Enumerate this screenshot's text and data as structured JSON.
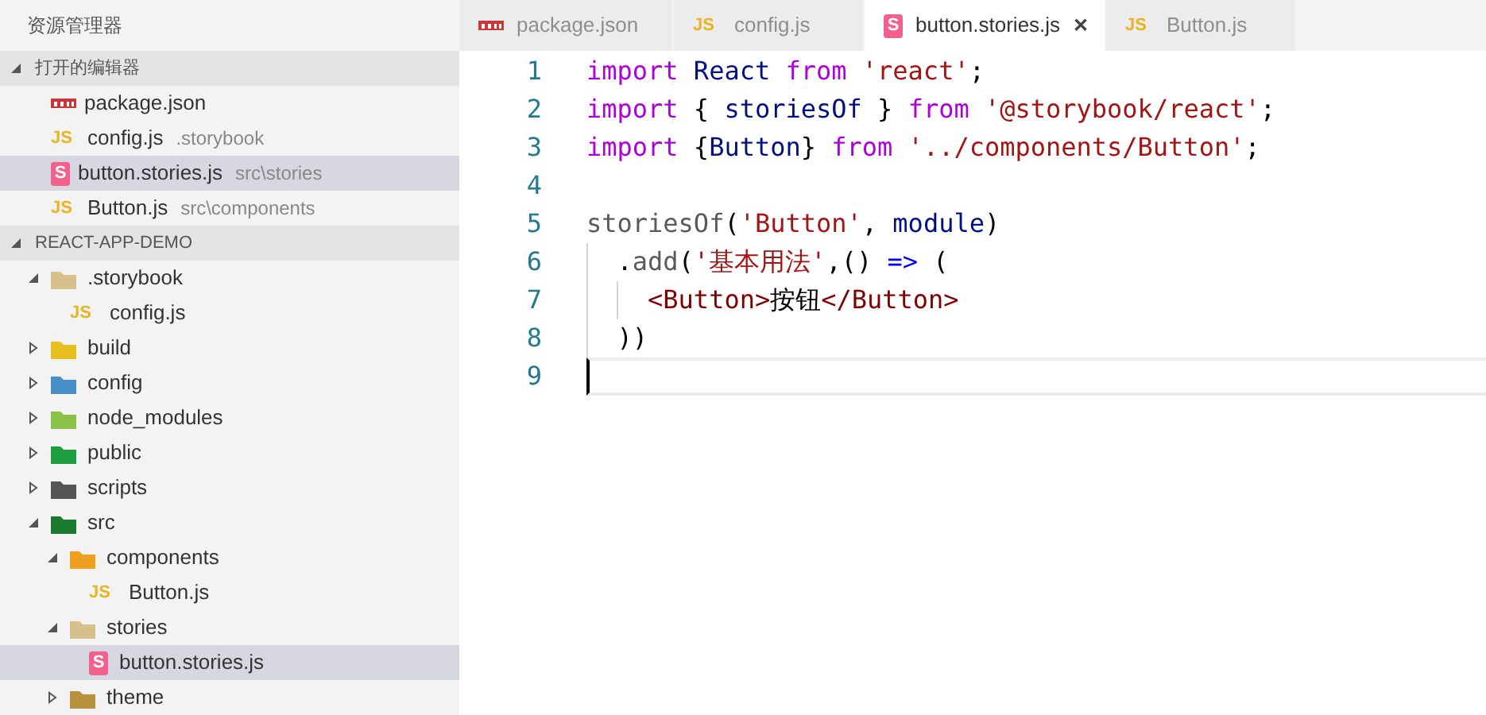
{
  "sidebar": {
    "title": "资源管理器",
    "open_editors": {
      "title": "打开的编辑器",
      "expanded": true,
      "items": [
        {
          "kind": "npm",
          "name": "package.json",
          "selected": false
        },
        {
          "kind": "js",
          "badge": "JS",
          "name": "config.js",
          "path": ".storybook",
          "selected": false
        },
        {
          "kind": "storybook",
          "badge": "S",
          "name": "button.stories.js",
          "path": "src\\stories",
          "selected": true
        },
        {
          "kind": "js",
          "badge": "JS",
          "name": "Button.js",
          "path": "src\\components",
          "selected": false
        }
      ]
    },
    "project": {
      "title": "REACT-APP-DEMO",
      "expanded": true,
      "tree": [
        {
          "kind": "folder",
          "name": ".storybook",
          "color": "#d7c08c",
          "expanded": true,
          "selected": false,
          "children": [
            {
              "kind": "js",
              "badge": "JS",
              "name": "config.js",
              "selected": false
            }
          ]
        },
        {
          "kind": "folder",
          "name": "build",
          "color": "#e8c020",
          "expanded": false,
          "selected": false
        },
        {
          "kind": "folder",
          "name": "config",
          "color": "#4a90c8",
          "expanded": false,
          "selected": false
        },
        {
          "kind": "folder",
          "name": "node_modules",
          "color": "#8bc34a",
          "expanded": false,
          "selected": false
        },
        {
          "kind": "folder",
          "name": "public",
          "color": "#1e9e3e",
          "expanded": false,
          "selected": false
        },
        {
          "kind": "folder",
          "name": "scripts",
          "color": "#555555",
          "expanded": false,
          "selected": false
        },
        {
          "kind": "folder",
          "name": "src",
          "color": "#1b7a2e",
          "expanded": true,
          "selected": false,
          "children": [
            {
              "kind": "folder",
              "name": "components",
              "color": "#f0a020",
              "expanded": true,
              "selected": false,
              "children": [
                {
                  "kind": "js",
                  "badge": "JS",
                  "name": "Button.js",
                  "selected": false
                }
              ]
            },
            {
              "kind": "folder",
              "name": "stories",
              "color": "#d7c08c",
              "expanded": true,
              "selected": false,
              "children": [
                {
                  "kind": "storybook",
                  "badge": "S",
                  "name": "button.stories.js",
                  "selected": true
                }
              ]
            },
            {
              "kind": "folder",
              "name": "theme",
              "color": "#b8913e",
              "expanded": false,
              "selected": false
            }
          ]
        }
      ]
    }
  },
  "tabs": [
    {
      "kind": "npm",
      "label": "package.json",
      "selected": false
    },
    {
      "kind": "js",
      "badge": "JS",
      "label": "config.js",
      "selected": false
    },
    {
      "kind": "storybook",
      "badge": "S",
      "label": "button.stories.js",
      "selected": true,
      "close": "✕"
    },
    {
      "kind": "js",
      "badge": "JS",
      "label": "Button.js",
      "selected": false
    }
  ],
  "editor": {
    "lines": [
      {
        "number": "1",
        "tokens": [
          {
            "kind": "keyword",
            "text": "import"
          },
          {
            "kind": "ident",
            "text": " React "
          },
          {
            "kind": "keyword",
            "text": "from"
          },
          {
            "kind": "string",
            "text": " 'react'"
          },
          {
            "kind": "plain",
            "text": ";"
          }
        ]
      },
      {
        "number": "2",
        "tokens": [
          {
            "kind": "keyword",
            "text": "import"
          },
          {
            "kind": "plain",
            "text": " { "
          },
          {
            "kind": "ident",
            "text": "storiesOf"
          },
          {
            "kind": "plain",
            "text": " } "
          },
          {
            "kind": "keyword",
            "text": "from"
          },
          {
            "kind": "string",
            "text": " '@storybook/react'"
          },
          {
            "kind": "plain",
            "text": ";"
          }
        ]
      },
      {
        "number": "3",
        "tokens": [
          {
            "kind": "keyword",
            "text": "import"
          },
          {
            "kind": "plain",
            "text": " {"
          },
          {
            "kind": "ident",
            "text": "Button"
          },
          {
            "kind": "plain",
            "text": "} "
          },
          {
            "kind": "keyword",
            "text": "from"
          },
          {
            "kind": "string",
            "text": " '../components/Button'"
          },
          {
            "kind": "plain",
            "text": ";"
          }
        ]
      },
      {
        "number": "4"
      },
      {
        "number": "5",
        "tokens": [
          {
            "kind": "function",
            "text": "storiesOf"
          },
          {
            "kind": "plain",
            "text": "("
          },
          {
            "kind": "string",
            "text": "'Button'"
          },
          {
            "kind": "plain",
            "text": ", "
          },
          {
            "kind": "ident",
            "text": "module"
          },
          {
            "kind": "plain",
            "text": ")"
          }
        ]
      },
      {
        "number": "6",
        "tokens": [
          {
            "kind": "plain",
            "text": "  ."
          },
          {
            "kind": "function",
            "text": "add"
          },
          {
            "kind": "plain",
            "text": "("
          },
          {
            "kind": "string",
            "text": "'基本用法'"
          },
          {
            "kind": "plain",
            "text": ",() "
          },
          {
            "kind": "operator",
            "text": "=>"
          },
          {
            "kind": "plain",
            "text": " ("
          }
        ]
      },
      {
        "number": "7",
        "tokens": [
          {
            "kind": "tag",
            "text": "    <Button>"
          },
          {
            "kind": "plain",
            "text": "按钮"
          },
          {
            "kind": "tag",
            "text": "</Button>"
          }
        ]
      },
      {
        "number": "8",
        "tokens": [
          {
            "kind": "plain",
            "text": "  ))"
          }
        ]
      },
      {
        "number": "9",
        "current": true
      }
    ]
  }
}
